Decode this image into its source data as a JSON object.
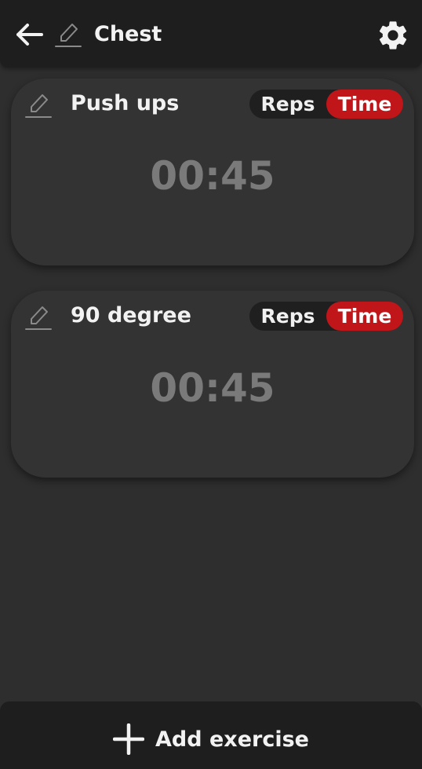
{
  "header": {
    "title": "Chest",
    "back_icon": "arrow-left-icon",
    "edit_icon": "pencil-icon",
    "settings_icon": "gear-icon"
  },
  "exercises": [
    {
      "name": "Push ups",
      "mode_options": [
        "Reps",
        "Time"
      ],
      "selected_mode": "Time",
      "time": "00:45",
      "edit_icon": "pencil-icon"
    },
    {
      "name": "90 degree",
      "mode_options": [
        "Reps",
        "Time"
      ],
      "selected_mode": "Time",
      "time": "00:45",
      "edit_icon": "pencil-icon"
    }
  ],
  "footer": {
    "add_label": "Add exercise",
    "add_icon": "plus-icon"
  },
  "colors": {
    "accent": "#c0161a",
    "background": "#2e2e2e",
    "card": "#333333",
    "bar": "#1e1e1e",
    "muted_text": "#7a7a7a"
  }
}
